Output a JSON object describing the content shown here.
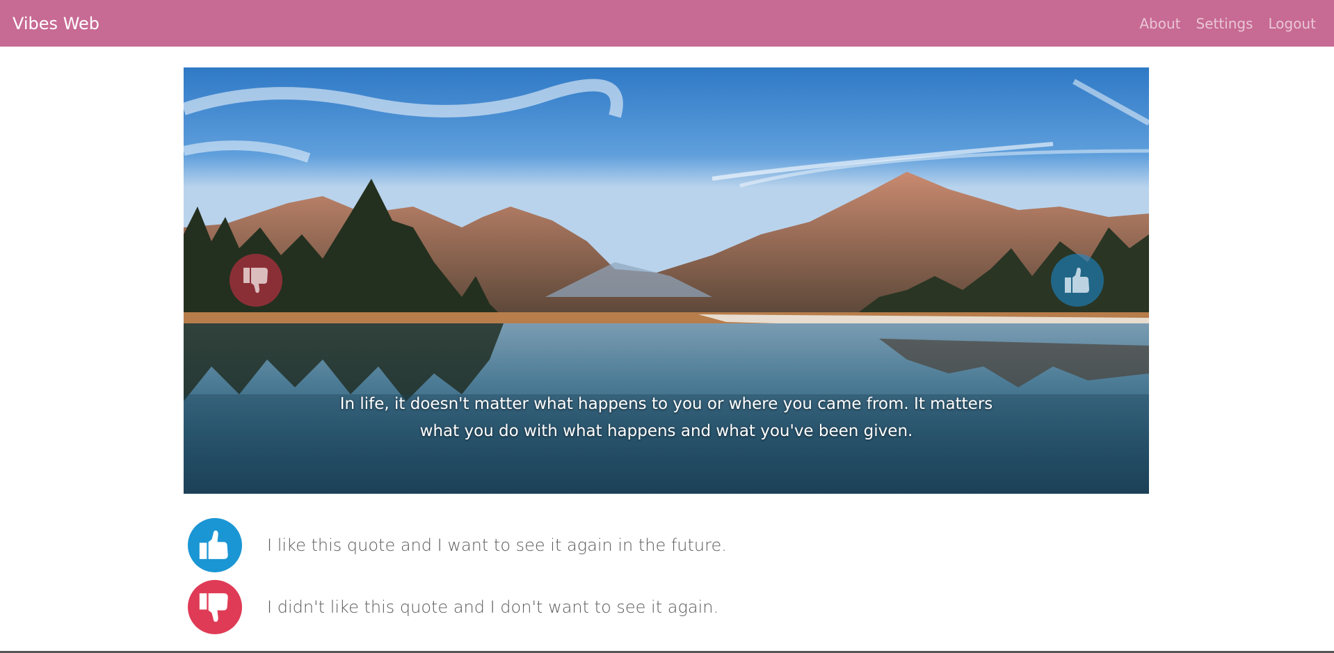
{
  "navbar": {
    "brand": "Vibes Web",
    "links": [
      "About",
      "Settings",
      "Logout"
    ],
    "color": "#c76a94"
  },
  "hero": {
    "quote": "In life, it doesn't matter what happens to you or where you came from. It matters what you do with what happens and what you've been given.",
    "dislike_icon": "thumbs-down-icon",
    "like_icon": "thumbs-up-icon"
  },
  "legend": {
    "like_text": "I like this quote and I want to see it again in the future.",
    "dislike_text": "I didn't like this quote and I don't want to see it again.",
    "like_color": "#1b96d4",
    "dislike_color": "#df3b56"
  }
}
